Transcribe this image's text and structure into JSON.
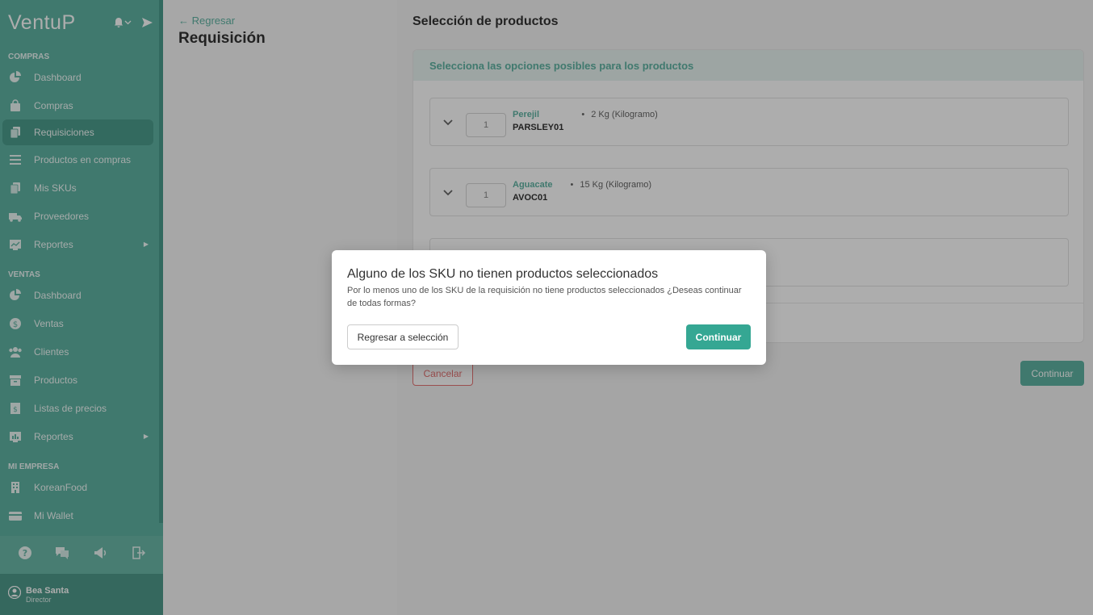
{
  "app": {
    "logo": "VentuP"
  },
  "colors": {
    "accent": "#5fb3a3",
    "danger": "#e57373",
    "primary_button": "#35a793"
  },
  "sidebar": {
    "sections": [
      {
        "title": "COMPRAS",
        "items": [
          {
            "label": "Dashboard",
            "icon": "pie-chart-icon"
          },
          {
            "label": "Compras",
            "icon": "shopping-bag-icon"
          },
          {
            "label": "Requisiciones",
            "icon": "documents-icon",
            "active": true
          },
          {
            "label": "Productos en compras",
            "icon": "list-icon"
          },
          {
            "label": "Mis SKUs",
            "icon": "sku-icon"
          },
          {
            "label": "Proveedores",
            "icon": "truck-icon"
          },
          {
            "label": "Reportes",
            "icon": "report-chart-icon",
            "submenu": true
          }
        ]
      },
      {
        "title": "VENTAS",
        "items": [
          {
            "label": "Dashboard",
            "icon": "pie-chart-icon"
          },
          {
            "label": "Ventas",
            "icon": "dollar-coin-icon"
          },
          {
            "label": "Clientes",
            "icon": "users-icon"
          },
          {
            "label": "Productos",
            "icon": "box-icon"
          },
          {
            "label": "Listas de precios",
            "icon": "price-list-icon"
          },
          {
            "label": "Reportes",
            "icon": "report-chart-icon",
            "submenu": true
          }
        ]
      },
      {
        "title": "MI EMPRESA",
        "items": [
          {
            "label": "KoreanFood",
            "icon": "building-icon"
          },
          {
            "label": "Mi Wallet",
            "icon": "wallet-icon"
          }
        ]
      }
    ],
    "user": {
      "name": "Bea Santa",
      "role": "Director"
    }
  },
  "header": {
    "back_label": "← Regresar",
    "title": "Requisición"
  },
  "main": {
    "section_title": "Selección de productos",
    "card_header": "Selecciona las opciones posibles para los productos",
    "products": [
      {
        "qty": "1",
        "name": "Perejil",
        "sku": "PARSLEY01",
        "amount": "2 Kg (Kilogramo)"
      },
      {
        "qty": "1",
        "name": "Aguacate",
        "sku": "AVOC01",
        "amount": "15 Kg (Kilogramo)"
      }
    ],
    "cancel_label": "Cancelar",
    "continue_label": "Continuar"
  },
  "modal": {
    "title": "Alguno de los SKU no tienen productos seleccionados",
    "body": "Por lo menos uno de los SKU de la requisición no tiene productos seleccionados ¿Deseas continuar de todas formas?",
    "back_label": "Regresar a selección",
    "continue_label": "Continuar"
  }
}
